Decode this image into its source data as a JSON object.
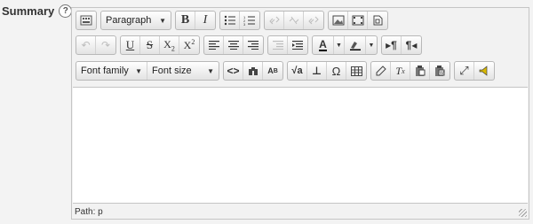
{
  "field": {
    "label": "Summary",
    "help_glyph": "?"
  },
  "toolbar": {
    "format_select": "Paragraph",
    "font_family_select": "Font family",
    "font_size_select": "Font size",
    "subscript": {
      "base": "X",
      "script": "2"
    },
    "superscript": {
      "base": "X",
      "script": "2"
    }
  },
  "editor": {
    "content_text": "",
    "status_prefix": "Path:",
    "status_path": "p"
  }
}
